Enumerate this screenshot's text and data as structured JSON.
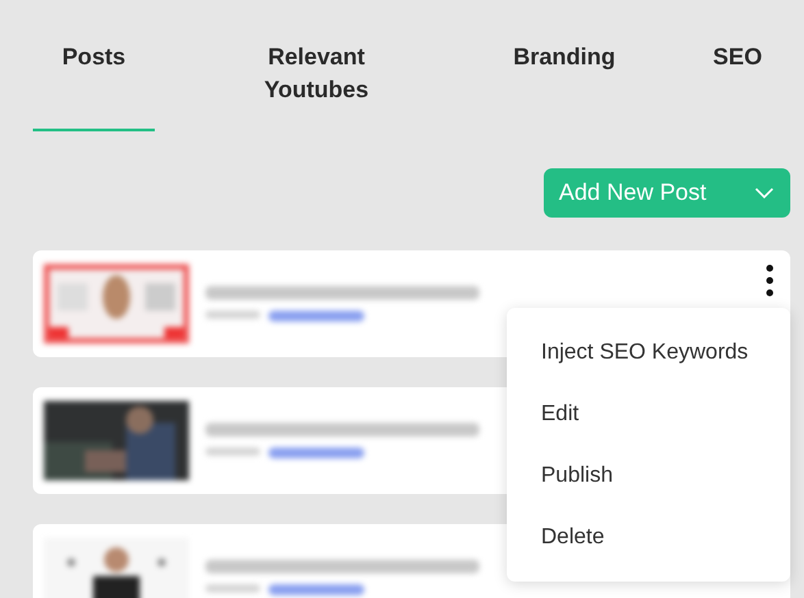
{
  "tabs": [
    {
      "label": "Posts",
      "selected": true
    },
    {
      "label": "Relevant Youtubes",
      "selected": false
    },
    {
      "label": "Branding",
      "selected": false
    },
    {
      "label": "SEO",
      "selected": false
    }
  ],
  "add_button": {
    "label": "Add New Post"
  },
  "posts": [
    {
      "menu_open": true
    },
    {
      "menu_open": false
    },
    {
      "menu_open": false
    }
  ],
  "menu": [
    "Inject SEO Keywords",
    "Edit",
    "Publish",
    "Delete"
  ]
}
